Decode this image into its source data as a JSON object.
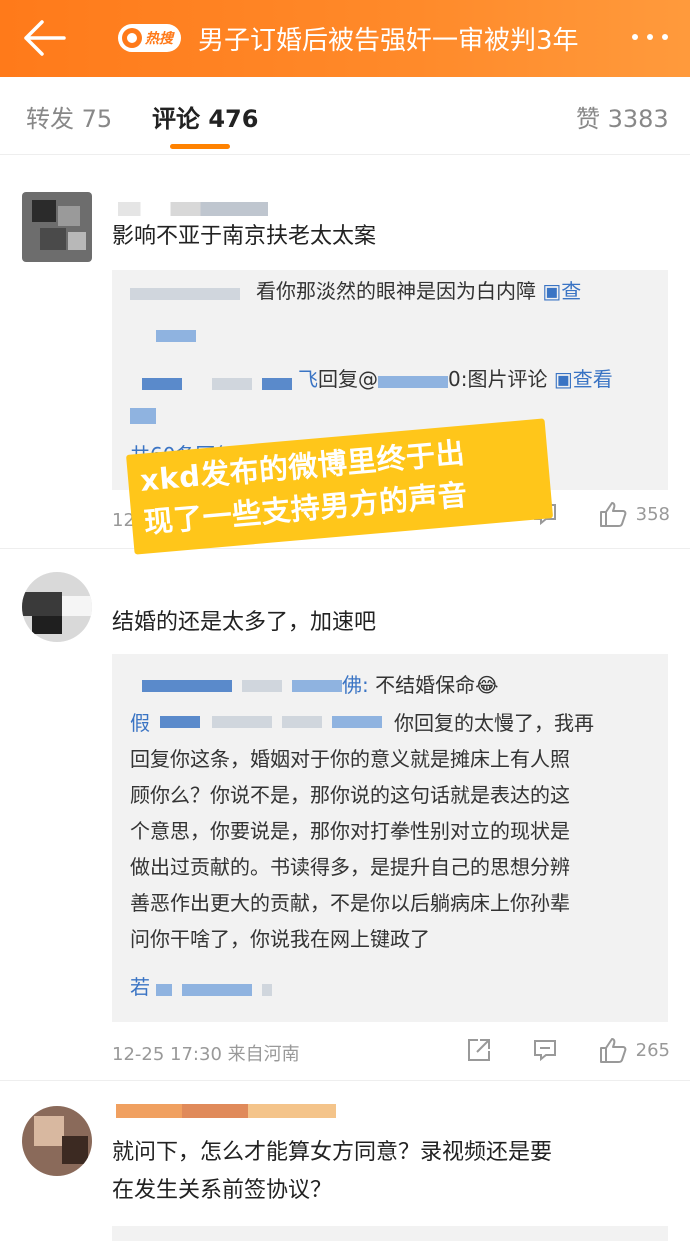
{
  "header": {
    "back_icon": "back-arrow-icon",
    "hot_badge_label": "热搜",
    "title": "男子订婚后被告强奸一审被判3年",
    "more_icon": "more-dots-icon",
    "background_color": "#ff7a1a"
  },
  "tabs": {
    "repost": "转发 75",
    "comments": "评论 476",
    "likes": "赞 3383",
    "accent_color": "#ff8200"
  },
  "comments": [
    {
      "text": "影响不亚于南京扶老太太案",
      "replies": [
        {
          "text": "看你那淡然的眼神是因为白内障",
          "link": "查"
        },
        {
          "prefix": "飞",
          "text": "回复@",
          "suffix": "0:图片评论",
          "link": "查看"
        }
      ],
      "more_replies": "共60条回复",
      "meta": "12",
      "likes": "358"
    },
    {
      "text": "结婚的还是太多了，加速吧",
      "replies": [
        {
          "suffix": "佛:",
          "text": " 不结婚保命"
        },
        {
          "prefix": "假",
          "text": "你回复的太慢了，我再",
          "lines": [
            "回复你这条，婚姻对于你的意义就是摊床上有人照",
            "顾你么？你说不是，那你说的这句话就是表达的这",
            "个意思，你要说是，那你对打拳性别对立的现状是",
            "做出过贡献的。书读得多，是提升自己的思想分辨",
            "善恶作出更大的贡献，不是你以后躺病床上你孙辈",
            "问你干啥了，你说我在网上键政了"
          ]
        }
      ],
      "reply_tail": "若",
      "meta": "12-25 17:30 来自河南",
      "likes": "265"
    },
    {
      "text_lines": [
        "就问下，怎么才能算女方同意？录视频还是要",
        "在发生关系前签协议？"
      ]
    }
  ],
  "banner": {
    "line1": "xkd发布的微博里终于出",
    "line2": "现了一些支持男方的声音",
    "color": "#ffc61a"
  },
  "icons": {
    "share": "share-icon",
    "comment": "comment-icon",
    "like": "thumbs-up-icon",
    "image": "image-icon",
    "chevron": "chevron-right-icon"
  }
}
